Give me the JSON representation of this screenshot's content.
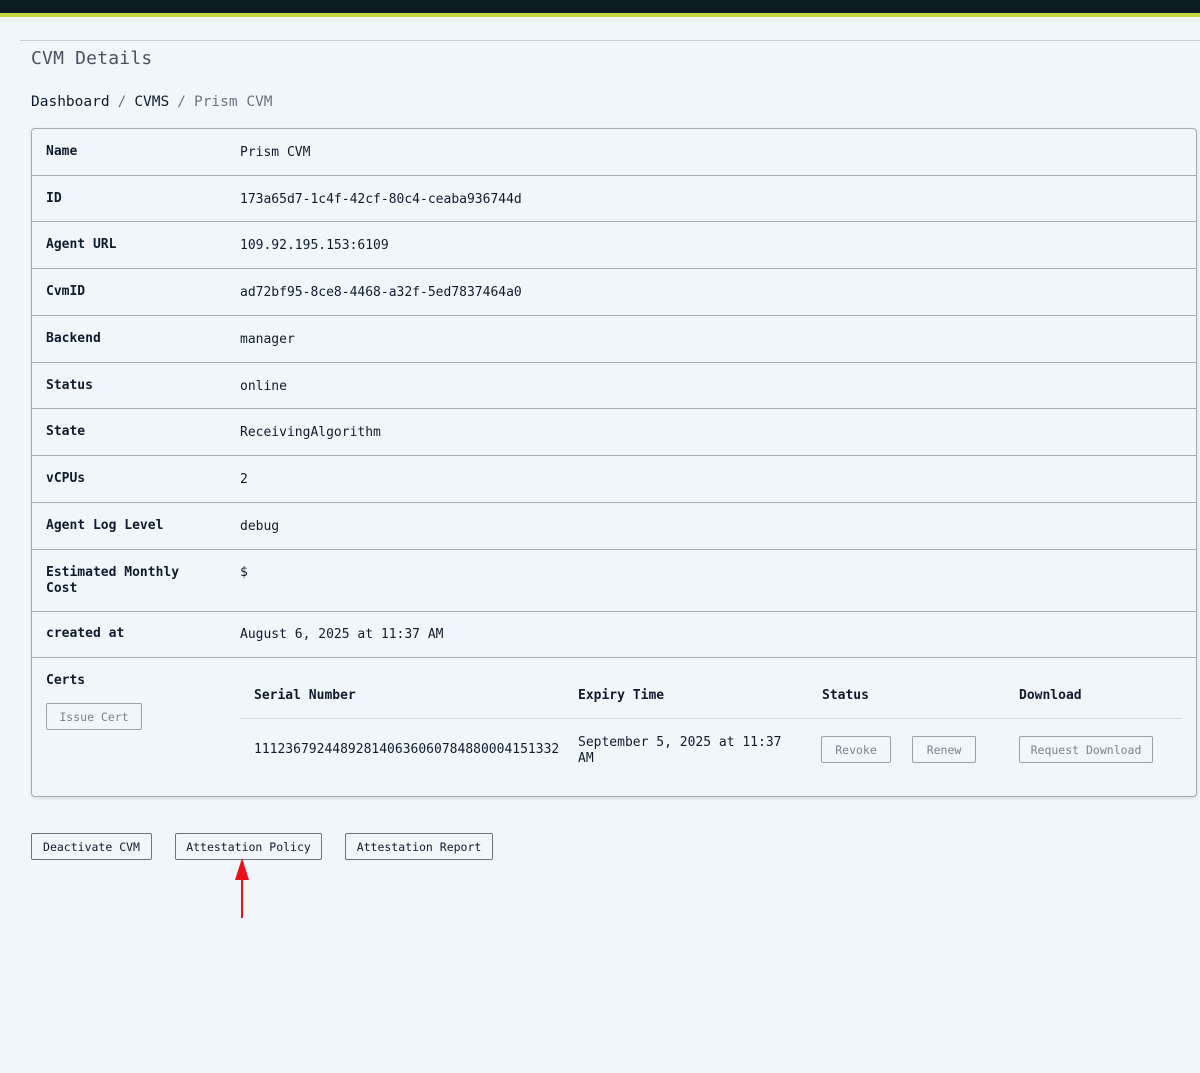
{
  "page": {
    "title": "CVM Details"
  },
  "breadcrumb": {
    "items": [
      "Dashboard",
      "CVMS",
      "Prism CVM"
    ],
    "separator": "/"
  },
  "details": {
    "rows": [
      {
        "label": "Name",
        "value": "Prism CVM"
      },
      {
        "label": "ID",
        "value": "173a65d7-1c4f-42cf-80c4-ceaba936744d"
      },
      {
        "label": "Agent URL",
        "value": "109.92.195.153:6109"
      },
      {
        "label": "CvmID",
        "value": "ad72bf95-8ce8-4468-a32f-5ed7837464a0"
      },
      {
        "label": "Backend",
        "value": "manager"
      },
      {
        "label": "Status",
        "value": "online"
      },
      {
        "label": "State",
        "value": "ReceivingAlgorithm"
      },
      {
        "label": "vCPUs",
        "value": "2"
      },
      {
        "label": "Agent Log Level",
        "value": "debug"
      },
      {
        "label": "Estimated Monthly Cost",
        "value": "$"
      },
      {
        "label": "created at",
        "value": "August 6, 2025 at 11:37 AM"
      }
    ]
  },
  "certs": {
    "label": "Certs",
    "issue_button": "Issue Cert",
    "columns": [
      "Serial Number",
      "Expiry Time",
      "Status",
      "Download"
    ],
    "rows": [
      {
        "serial": "111236792448928140636060784880004151332",
        "expiry": "September 5, 2025 at 11:37 AM",
        "revoke_label": "Revoke",
        "renew_label": "Renew",
        "download_label": "Request Download"
      }
    ]
  },
  "actions": {
    "deactivate": "Deactivate CVM",
    "attestation_policy": "Attestation Policy",
    "attestation_report": "Attestation Report"
  },
  "colors": {
    "topbar": "#0c1c22",
    "accent": "#c7d83e",
    "annotation_arrow": "#e8101a"
  }
}
